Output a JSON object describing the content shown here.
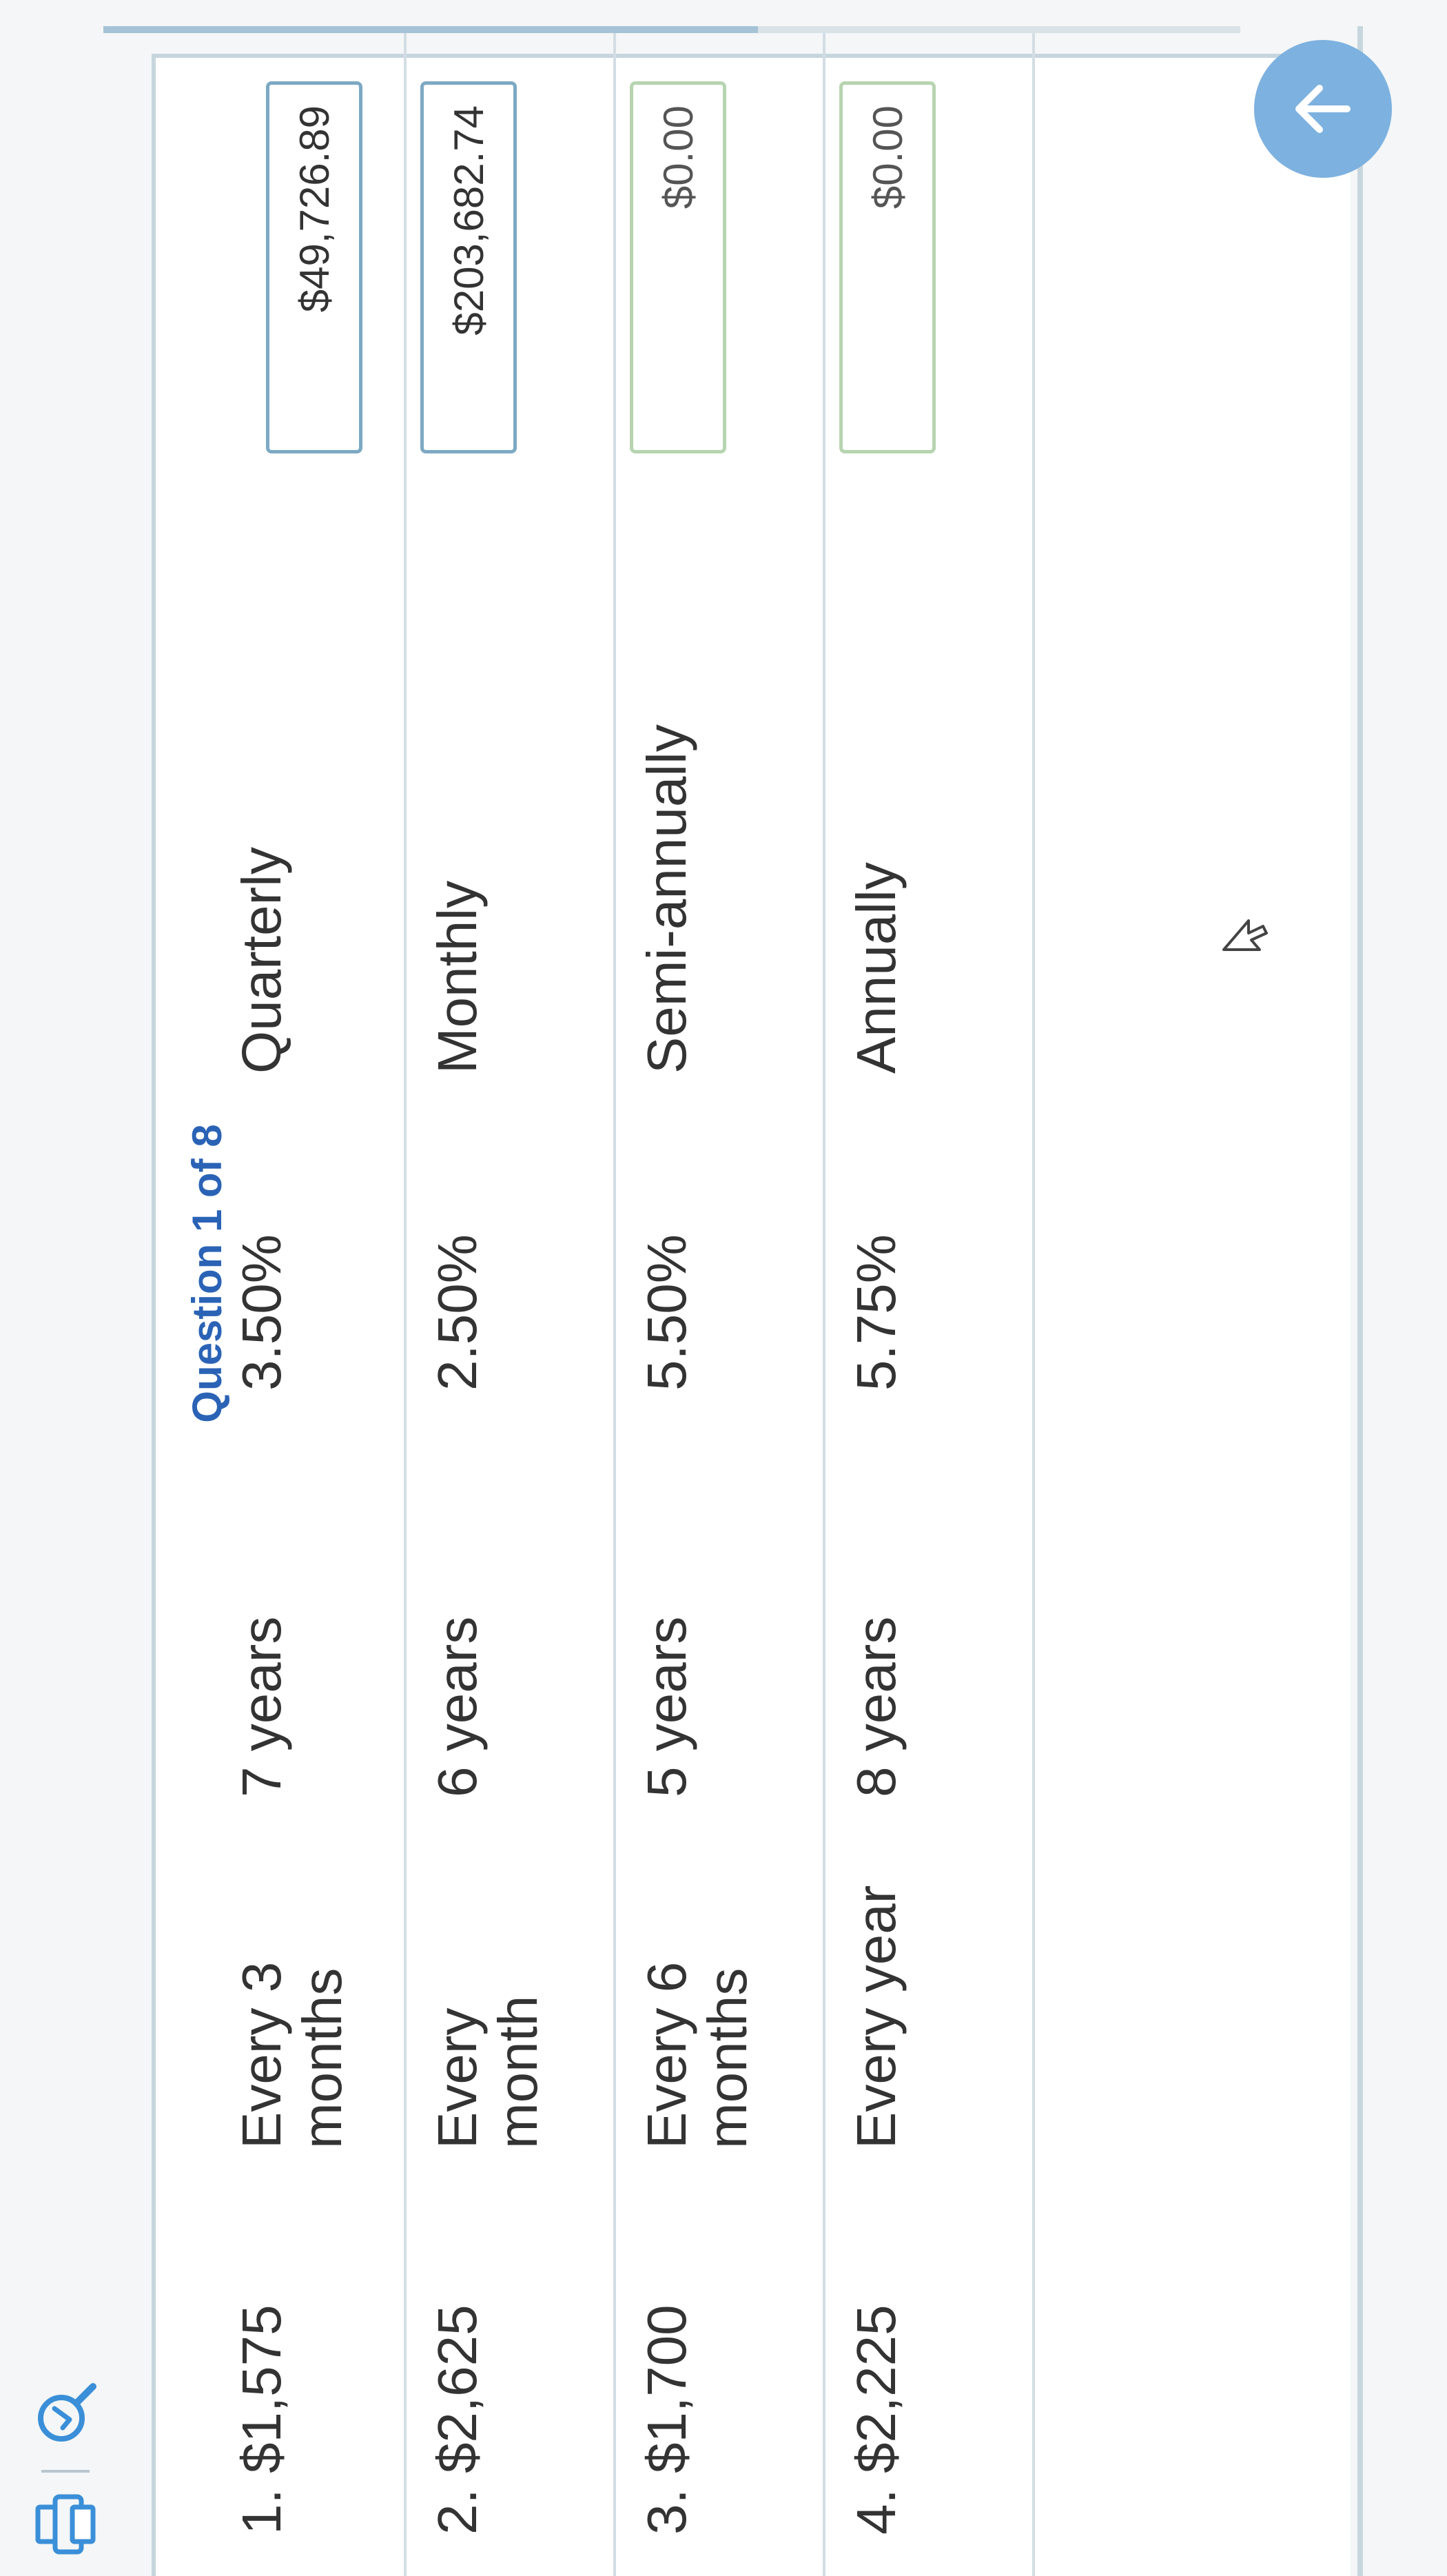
{
  "header": {
    "question_counter": "Question 1 of 8"
  },
  "icons": {
    "print": "printer-icon",
    "zoom": "zoom-icon",
    "next": "arrow-up-icon"
  },
  "rows": [
    {
      "principal": "1. $1,575",
      "frequency": "Every 3 months",
      "term": "7 years",
      "rate": "3.50%",
      "compounding": "Quarterly",
      "answer": "$49,726.89"
    },
    {
      "principal": "2. $2,625",
      "frequency": "Every month",
      "term": "6 years",
      "rate": "2.50%",
      "compounding": "Monthly",
      "answer": "$203,682.74"
    },
    {
      "principal": "3. $1,700",
      "frequency": "Every 6 months",
      "term": "5 years",
      "rate": "5.50%",
      "compounding": "Semi-annually",
      "answer": "$0.00"
    },
    {
      "principal": "4. $2,225",
      "frequency": "Every year",
      "term": "8 years",
      "rate": "5.75%",
      "compounding": "Annually",
      "answer": "$0.00"
    }
  ],
  "colors": {
    "accent": "#2a63b6",
    "icon": "#3a8fd8",
    "fab": "#7db1df",
    "answer_border_filled": "#7da9c3",
    "answer_border_empty": "#b6d4b0"
  }
}
